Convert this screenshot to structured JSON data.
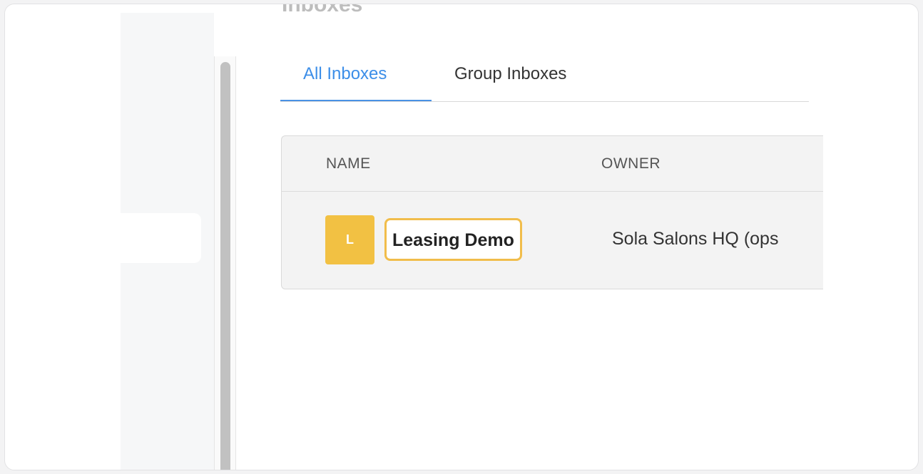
{
  "page": {
    "heading": "Inboxes"
  },
  "tabs": [
    {
      "label": "All Inboxes",
      "active": true
    },
    {
      "label": "Group Inboxes",
      "active": false
    }
  ],
  "table": {
    "columns": [
      "NAME",
      "OWNER"
    ],
    "rows": [
      {
        "avatar_letter": "L",
        "name": "Leasing Demo",
        "owner": "Sola Salons HQ (ops"
      }
    ]
  },
  "colors": {
    "accent": "#3c8ee8",
    "avatar": "#f2c143",
    "highlight_border": "#f1bd4b"
  }
}
